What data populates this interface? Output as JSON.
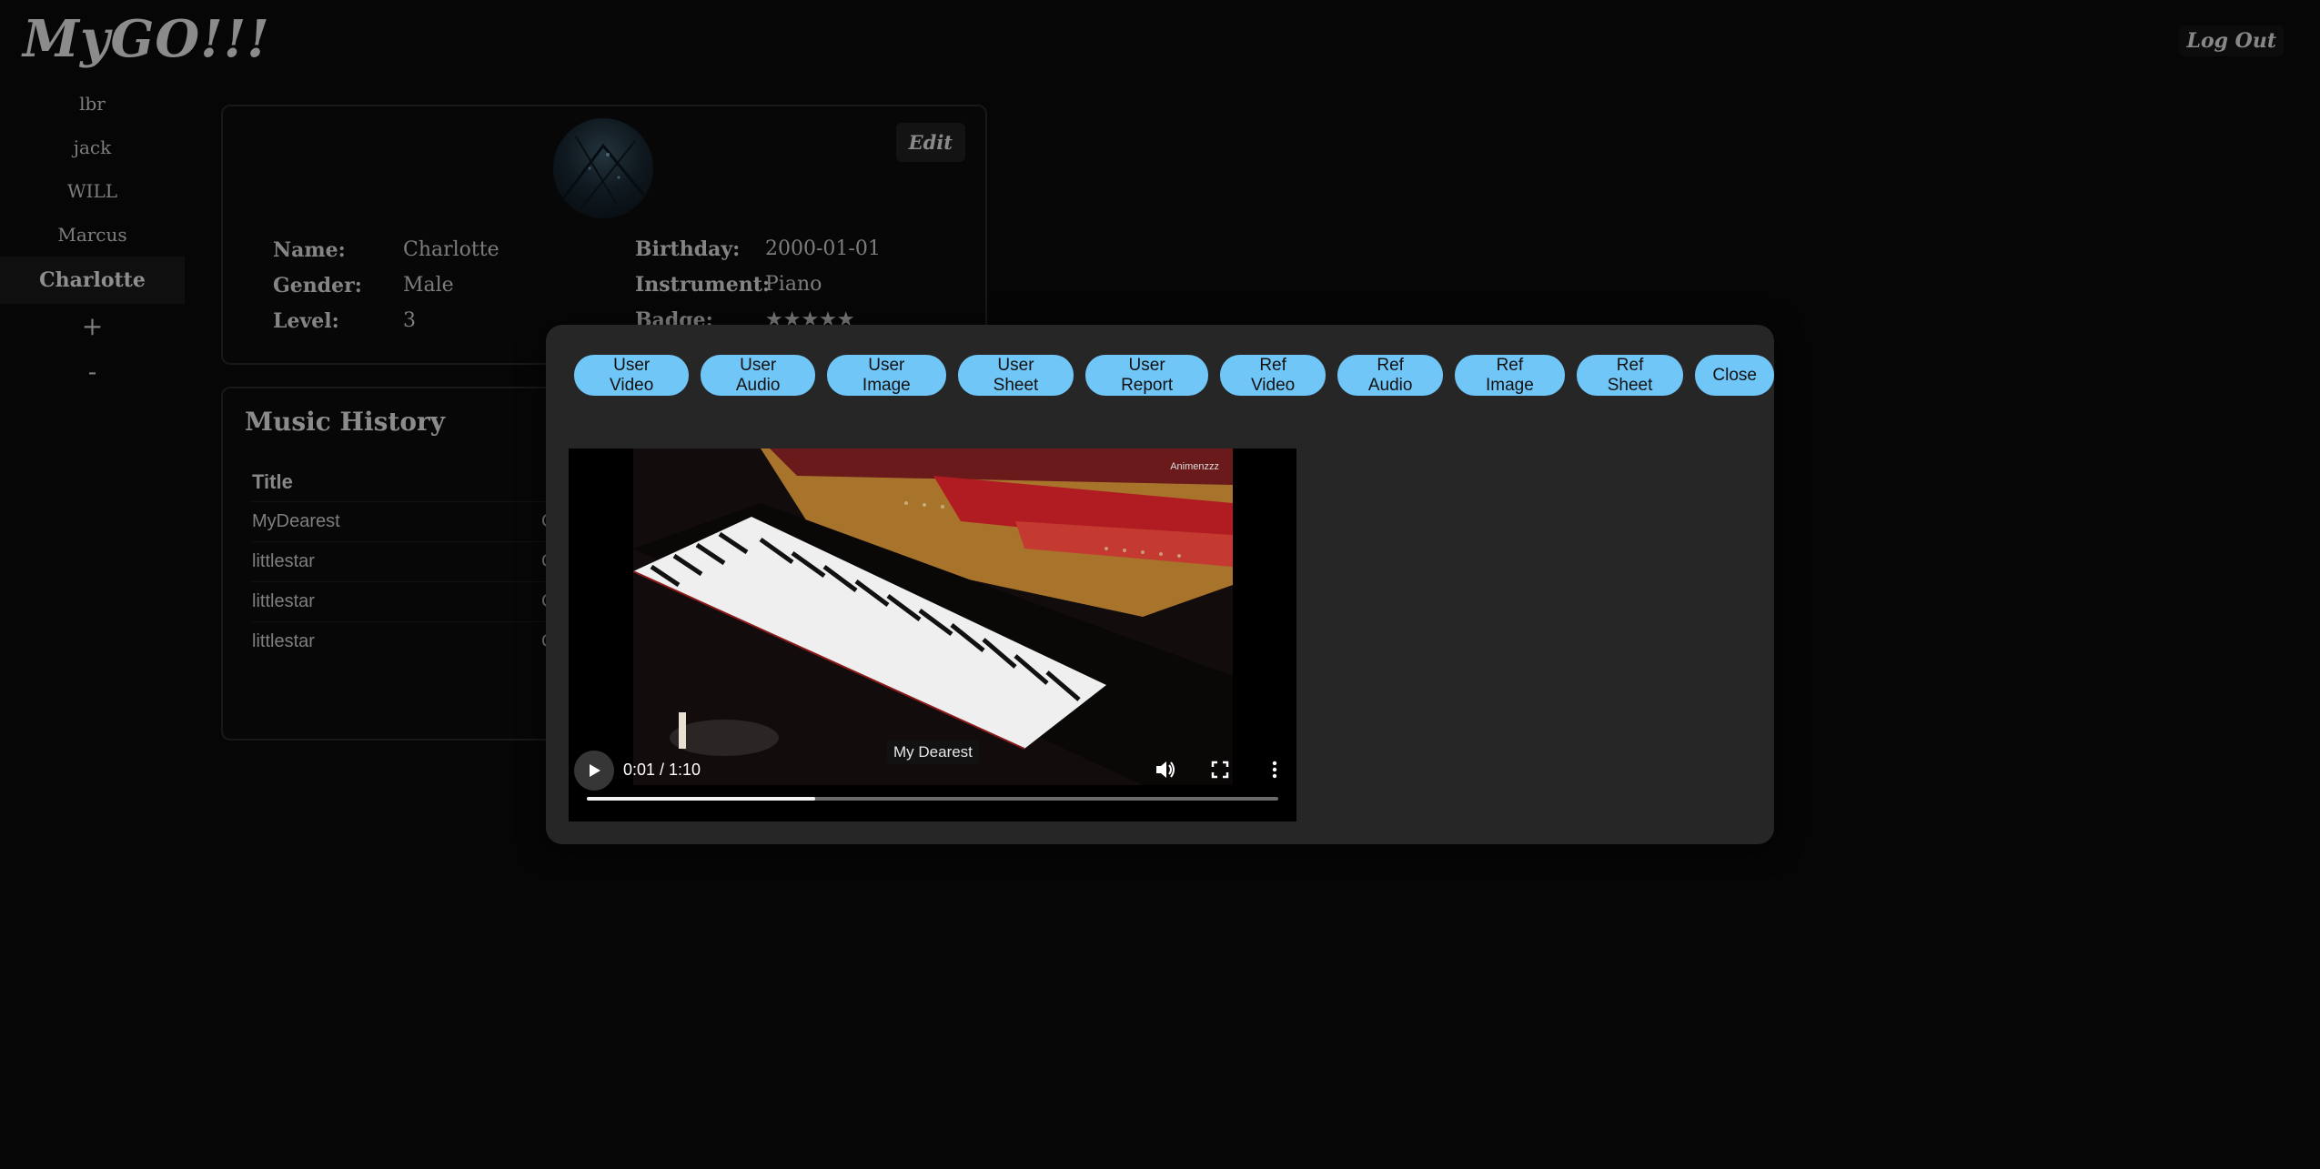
{
  "app": {
    "title": "MyGO!!!",
    "logout_label": "Log Out"
  },
  "sidebar": {
    "items": [
      {
        "label": "lbr"
      },
      {
        "label": "jack"
      },
      {
        "label": "WILL"
      },
      {
        "label": "Marcus"
      },
      {
        "label": "Charlotte",
        "active": true
      }
    ],
    "add_label": "+",
    "remove_label": "-"
  },
  "profile": {
    "edit_label": "Edit",
    "name_label": "Name:",
    "name": "Charlotte",
    "gender_label": "Gender:",
    "gender": "Male",
    "level_label": "Level:",
    "level": "3",
    "birthday_label": "Birthday:",
    "birthday": "2000-01-01",
    "instrument_label": "Instrument:",
    "instrument": "Piano",
    "badge_label": "Badge:",
    "badge": "★★★★★"
  },
  "history": {
    "title": "Music History",
    "columns": [
      "Title"
    ],
    "rows": [
      {
        "title": "MyDearest",
        "col2": "C"
      },
      {
        "title": "littlestar",
        "col2": "C"
      },
      {
        "title": "littlestar",
        "col2": "C"
      },
      {
        "title": "littlestar",
        "col2": "C"
      }
    ]
  },
  "modal": {
    "buttons": {
      "user_video": "User Video",
      "user_audio": "User Audio",
      "user_image": "User Image",
      "user_sheet": "User Sheet",
      "user_report": "User Report",
      "ref_video": "Ref Video",
      "ref_audio": "Ref Audio",
      "ref_image": "Ref Image",
      "ref_sheet": "Ref Sheet",
      "close": "Close"
    },
    "video": {
      "current_time": "0:01",
      "duration": "1:10",
      "timecode": "0:01 / 1:10",
      "caption": "My Dearest",
      "watermark": "Animenzzz",
      "progress_fraction": 0.33
    }
  },
  "colors": {
    "accent": "#71c6f8",
    "background": "#0b0b0b",
    "modal": "#262627"
  }
}
